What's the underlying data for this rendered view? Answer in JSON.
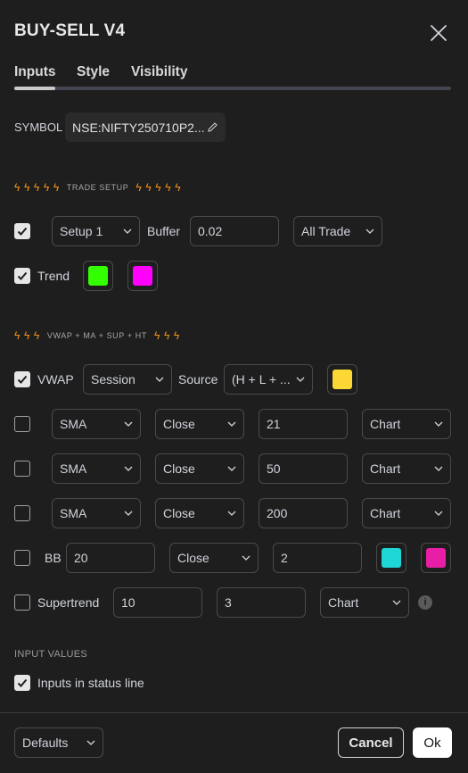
{
  "dialog": {
    "title": "BUY-SELL V4"
  },
  "tabs": [
    {
      "label": "Inputs",
      "active": true
    },
    {
      "label": "Style",
      "active": false
    },
    {
      "label": "Visibility",
      "active": false
    }
  ],
  "symbol": {
    "label": "SYMBOL",
    "value": "NSE:NIFTY250710P2..."
  },
  "trade_setup": {
    "header": "TRADE SETUP",
    "setup": {
      "checked": true,
      "selected": "Setup 1",
      "buffer_label": "Buffer",
      "buffer_value": "0.02",
      "mode": "All Trade"
    },
    "trend": {
      "checked": true,
      "label": "Trend",
      "color_up": "#33ff00",
      "color_down": "#ff00ff"
    }
  },
  "vwap_section": {
    "header": "VWAP + MA + SUP + HT",
    "vwap": {
      "checked": true,
      "label": "VWAP",
      "anchor": "Session",
      "source_label": "Source",
      "source": "(H + L + ...",
      "color": "#fdd835"
    },
    "ma_rows": [
      {
        "checked": false,
        "type": "SMA",
        "source": "Close",
        "length": "21",
        "timeframe": "Chart"
      },
      {
        "checked": false,
        "type": "SMA",
        "source": "Close",
        "length": "50",
        "timeframe": "Chart"
      },
      {
        "checked": false,
        "type": "SMA",
        "source": "Close",
        "length": "200",
        "timeframe": "Chart"
      }
    ],
    "bb": {
      "checked": false,
      "label": "BB",
      "length": "20",
      "source": "Close",
      "mult": "2",
      "color_upper": "#1ed6d6",
      "color_lower": "#e91ea6"
    },
    "supertrend": {
      "checked": false,
      "label": "Supertrend",
      "period": "10",
      "factor": "3",
      "timeframe": "Chart"
    }
  },
  "input_values": {
    "header": "INPUT VALUES",
    "status_line": {
      "checked": true,
      "label": "Inputs in status line"
    }
  },
  "footer": {
    "defaults_label": "Defaults",
    "cancel_label": "Cancel",
    "ok_label": "Ok"
  },
  "colors": {
    "background": "#1e1e1e",
    "accent_bolt": "#f7931a"
  }
}
